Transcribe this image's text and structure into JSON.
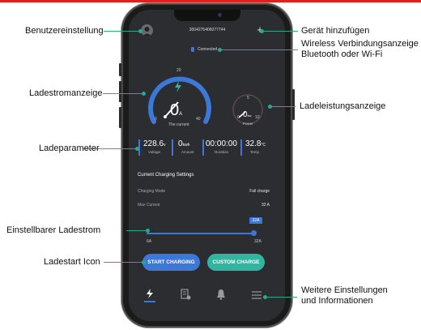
{
  "callouts": {
    "user_settings": "Benutzereinstellung",
    "add_device": "Gerät hinzufügen",
    "wireless_line1": "Wireless Verbindungsanzeige",
    "wireless_line2": "Bluetooth oder Wi-Fi",
    "current_display": "Ladestromanzeige",
    "power_display": "Ladeleistungsanzeige",
    "charge_params": "Ladeparameter",
    "adjustable_current": "Einstellbarer Ladestrom",
    "start_icon": "Ladestart Icon",
    "more_line1": "Weitere Einstellungen",
    "more_line2": "und Informationen"
  },
  "app": {
    "device_id": "3004275406077744",
    "connection_status": "Connected",
    "current_gauge": {
      "value": "0",
      "unit": "A",
      "label": "The current",
      "scale_min": "0",
      "scale_mid": "20",
      "scale_max": "40"
    },
    "power_gauge": {
      "value": "0",
      "unit": "kw",
      "label": "Power",
      "scale_min": "0",
      "scale_mid": "5",
      "scale_max": "10"
    },
    "params": [
      {
        "value": "228.6",
        "unit": "v",
        "label": "Voltage"
      },
      {
        "value": "0",
        "unit": "kwh",
        "label": "Amount"
      },
      {
        "value": "00:00:00",
        "unit": "",
        "label": "Duration"
      },
      {
        "value": "32.8",
        "unit": "°C",
        "label": "Temp"
      }
    ],
    "settings": {
      "title": "Current Charging Settings",
      "mode_label": "Charging Mode",
      "mode_value": "Full charge",
      "max_label": "Max Current",
      "max_value": "32 A"
    },
    "slider": {
      "badge": "32A",
      "min_label": "6A",
      "max_label": "32A",
      "level_fraction": 1.0
    },
    "buttons": {
      "start": "START CHARGING",
      "custom": "CUSTOM CHARGE"
    },
    "colors": {
      "accent_blue": "#3c78d8",
      "accent_teal": "#2fb5a0",
      "screen_bg": "#2b2d30"
    }
  }
}
